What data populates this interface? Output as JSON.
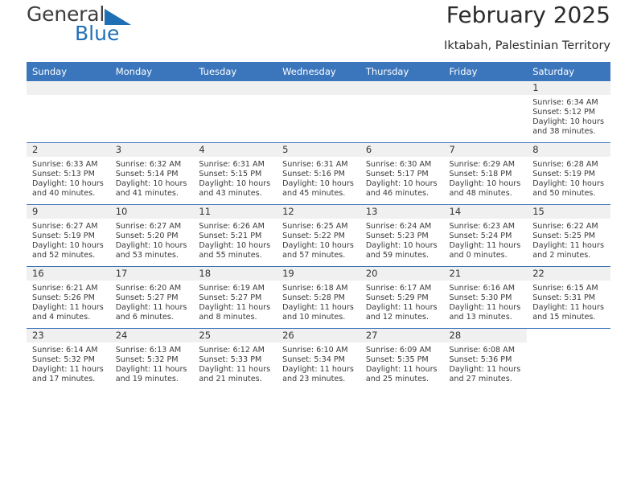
{
  "brand": {
    "name_primary": "General",
    "name_secondary": "Blue",
    "triangle_color": "#1f6fb5"
  },
  "header": {
    "title": "February 2025",
    "subtitle": "Iktabah, Palestinian Territory"
  },
  "theme": {
    "header_blue": "#3b76bc",
    "daynum_gray": "#f0f0f0",
    "text": "#333333"
  },
  "calendar": {
    "weekday_headers": [
      "Sunday",
      "Monday",
      "Tuesday",
      "Wednesday",
      "Thursday",
      "Friday",
      "Saturday"
    ],
    "weeks": [
      [
        {
          "day": "",
          "lines": []
        },
        {
          "day": "",
          "lines": []
        },
        {
          "day": "",
          "lines": []
        },
        {
          "day": "",
          "lines": []
        },
        {
          "day": "",
          "lines": []
        },
        {
          "day": "",
          "lines": []
        },
        {
          "day": "1",
          "lines": [
            "Sunrise: 6:34 AM",
            "Sunset: 5:12 PM",
            "Daylight: 10 hours and 38 minutes."
          ]
        }
      ],
      [
        {
          "day": "2",
          "lines": [
            "Sunrise: 6:33 AM",
            "Sunset: 5:13 PM",
            "Daylight: 10 hours and 40 minutes."
          ]
        },
        {
          "day": "3",
          "lines": [
            "Sunrise: 6:32 AM",
            "Sunset: 5:14 PM",
            "Daylight: 10 hours and 41 minutes."
          ]
        },
        {
          "day": "4",
          "lines": [
            "Sunrise: 6:31 AM",
            "Sunset: 5:15 PM",
            "Daylight: 10 hours and 43 minutes."
          ]
        },
        {
          "day": "5",
          "lines": [
            "Sunrise: 6:31 AM",
            "Sunset: 5:16 PM",
            "Daylight: 10 hours and 45 minutes."
          ]
        },
        {
          "day": "6",
          "lines": [
            "Sunrise: 6:30 AM",
            "Sunset: 5:17 PM",
            "Daylight: 10 hours and 46 minutes."
          ]
        },
        {
          "day": "7",
          "lines": [
            "Sunrise: 6:29 AM",
            "Sunset: 5:18 PM",
            "Daylight: 10 hours and 48 minutes."
          ]
        },
        {
          "day": "8",
          "lines": [
            "Sunrise: 6:28 AM",
            "Sunset: 5:19 PM",
            "Daylight: 10 hours and 50 minutes."
          ]
        }
      ],
      [
        {
          "day": "9",
          "lines": [
            "Sunrise: 6:27 AM",
            "Sunset: 5:19 PM",
            "Daylight: 10 hours and 52 minutes."
          ]
        },
        {
          "day": "10",
          "lines": [
            "Sunrise: 6:27 AM",
            "Sunset: 5:20 PM",
            "Daylight: 10 hours and 53 minutes."
          ]
        },
        {
          "day": "11",
          "lines": [
            "Sunrise: 6:26 AM",
            "Sunset: 5:21 PM",
            "Daylight: 10 hours and 55 minutes."
          ]
        },
        {
          "day": "12",
          "lines": [
            "Sunrise: 6:25 AM",
            "Sunset: 5:22 PM",
            "Daylight: 10 hours and 57 minutes."
          ]
        },
        {
          "day": "13",
          "lines": [
            "Sunrise: 6:24 AM",
            "Sunset: 5:23 PM",
            "Daylight: 10 hours and 59 minutes."
          ]
        },
        {
          "day": "14",
          "lines": [
            "Sunrise: 6:23 AM",
            "Sunset: 5:24 PM",
            "Daylight: 11 hours and 0 minutes."
          ]
        },
        {
          "day": "15",
          "lines": [
            "Sunrise: 6:22 AM",
            "Sunset: 5:25 PM",
            "Daylight: 11 hours and 2 minutes."
          ]
        }
      ],
      [
        {
          "day": "16",
          "lines": [
            "Sunrise: 6:21 AM",
            "Sunset: 5:26 PM",
            "Daylight: 11 hours and 4 minutes."
          ]
        },
        {
          "day": "17",
          "lines": [
            "Sunrise: 6:20 AM",
            "Sunset: 5:27 PM",
            "Daylight: 11 hours and 6 minutes."
          ]
        },
        {
          "day": "18",
          "lines": [
            "Sunrise: 6:19 AM",
            "Sunset: 5:27 PM",
            "Daylight: 11 hours and 8 minutes."
          ]
        },
        {
          "day": "19",
          "lines": [
            "Sunrise: 6:18 AM",
            "Sunset: 5:28 PM",
            "Daylight: 11 hours and 10 minutes."
          ]
        },
        {
          "day": "20",
          "lines": [
            "Sunrise: 6:17 AM",
            "Sunset: 5:29 PM",
            "Daylight: 11 hours and 12 minutes."
          ]
        },
        {
          "day": "21",
          "lines": [
            "Sunrise: 6:16 AM",
            "Sunset: 5:30 PM",
            "Daylight: 11 hours and 13 minutes."
          ]
        },
        {
          "day": "22",
          "lines": [
            "Sunrise: 6:15 AM",
            "Sunset: 5:31 PM",
            "Daylight: 11 hours and 15 minutes."
          ]
        }
      ],
      [
        {
          "day": "23",
          "lines": [
            "Sunrise: 6:14 AM",
            "Sunset: 5:32 PM",
            "Daylight: 11 hours and 17 minutes."
          ]
        },
        {
          "day": "24",
          "lines": [
            "Sunrise: 6:13 AM",
            "Sunset: 5:32 PM",
            "Daylight: 11 hours and 19 minutes."
          ]
        },
        {
          "day": "25",
          "lines": [
            "Sunrise: 6:12 AM",
            "Sunset: 5:33 PM",
            "Daylight: 11 hours and 21 minutes."
          ]
        },
        {
          "day": "26",
          "lines": [
            "Sunrise: 6:10 AM",
            "Sunset: 5:34 PM",
            "Daylight: 11 hours and 23 minutes."
          ]
        },
        {
          "day": "27",
          "lines": [
            "Sunrise: 6:09 AM",
            "Sunset: 5:35 PM",
            "Daylight: 11 hours and 25 minutes."
          ]
        },
        {
          "day": "28",
          "lines": [
            "Sunrise: 6:08 AM",
            "Sunset: 5:36 PM",
            "Daylight: 11 hours and 27 minutes."
          ]
        },
        {
          "day": "",
          "lines": []
        }
      ]
    ]
  }
}
